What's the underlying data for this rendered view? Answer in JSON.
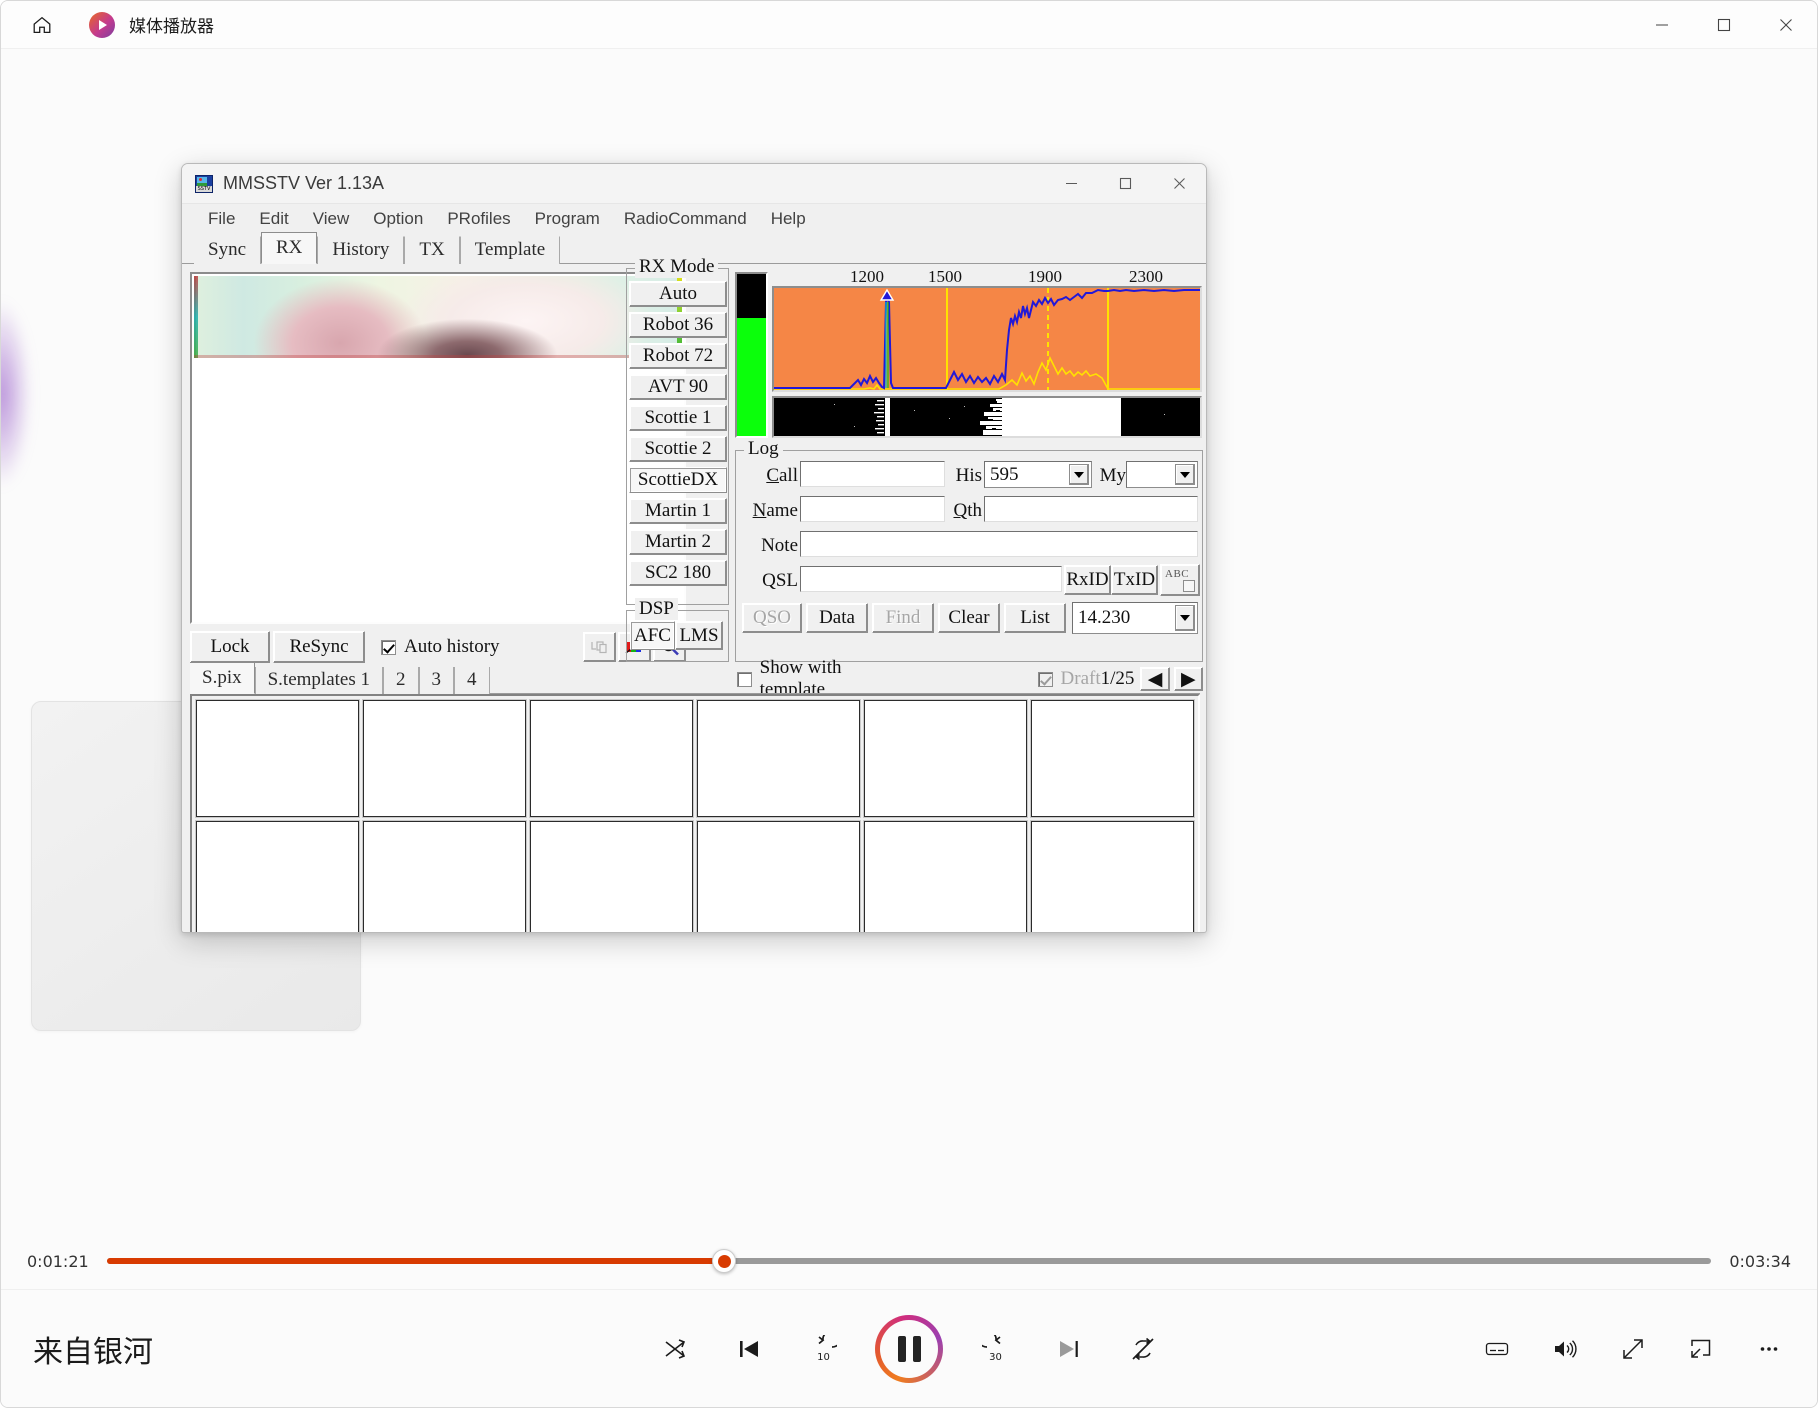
{
  "player": {
    "app_title": "媒体播放器",
    "home_icon": "home-icon",
    "window_controls": {
      "minimize": "—",
      "maximize": "□",
      "close": "✕"
    },
    "track_title": "来自银河",
    "time_current": "0:01:21",
    "time_total": "0:03:34",
    "progress_percent": 38.5,
    "accent_color": "#d83b01",
    "transport": [
      {
        "name": "shuffle-button",
        "label": "shuffle"
      },
      {
        "name": "previous-button",
        "label": "previous"
      },
      {
        "name": "rewind-10-button",
        "label": "10"
      },
      {
        "name": "play-pause-button",
        "label": "pause"
      },
      {
        "name": "forward-30-button",
        "label": "30"
      },
      {
        "name": "next-button",
        "label": "next"
      },
      {
        "name": "repeat-button",
        "label": "repeat-off"
      }
    ],
    "right_controls": [
      {
        "name": "captions-button",
        "label": "captions"
      },
      {
        "name": "volume-button",
        "label": "volume"
      },
      {
        "name": "fullscreen-button",
        "label": "fullscreen"
      },
      {
        "name": "miniplayer-button",
        "label": "miniplayer"
      },
      {
        "name": "more-options-button",
        "label": "..."
      }
    ]
  },
  "mmsstv": {
    "title": "MMSSTV Ver 1.13A",
    "window_controls": {
      "minimize": "—",
      "maximize": "□",
      "close": "✕"
    },
    "menu": [
      "File",
      "Edit",
      "View",
      "Option",
      "PRofiles",
      "Program",
      "RadioCommand",
      "Help"
    ],
    "tabs": [
      {
        "label": "Sync",
        "selected": false
      },
      {
        "label": "RX",
        "selected": true
      },
      {
        "label": "History",
        "selected": false
      },
      {
        "label": "TX",
        "selected": false
      },
      {
        "label": "Template",
        "selected": false
      }
    ],
    "sub_tabs": [
      {
        "label": "S.pix",
        "selected": true
      },
      {
        "label": "S.templates 1",
        "selected": false
      },
      {
        "label": "2",
        "selected": false
      },
      {
        "label": "3",
        "selected": false
      },
      {
        "label": "4",
        "selected": false
      }
    ],
    "rx_controls": {
      "lock": "Lock",
      "resync": "ReSync",
      "auto_history_label": "Auto history",
      "auto_history_checked": true,
      "icons": [
        {
          "name": "copy-to-clipboard-icon"
        },
        {
          "name": "color-adjust-icon"
        },
        {
          "name": "zoom-search-icon"
        }
      ]
    },
    "rx_mode": {
      "legend": "RX Mode",
      "modes": [
        {
          "label": "Auto",
          "selected": false
        },
        {
          "label": "Robot 36",
          "selected": false
        },
        {
          "label": "Robot 72",
          "selected": false
        },
        {
          "label": "AVT 90",
          "selected": false
        },
        {
          "label": "Scottie 1",
          "selected": false
        },
        {
          "label": "Scottie 2",
          "selected": false
        },
        {
          "label": "ScottieDX",
          "selected": true
        },
        {
          "label": "Martin 1",
          "selected": false
        },
        {
          "label": "Martin 2",
          "selected": false
        },
        {
          "label": "SC2 180",
          "selected": false
        }
      ]
    },
    "dsp": {
      "legend": "DSP",
      "afc": {
        "label": "AFC",
        "active": true
      },
      "lms": {
        "label": "LMS",
        "active": false
      }
    },
    "spectrum": {
      "axis_labels": [
        "1200",
        "1500",
        "1900",
        "2300"
      ],
      "meter_level_percent": 73,
      "bg_color": "#f58646",
      "trace_color": "#2218d8",
      "marker_color": "#ffe100"
    },
    "log": {
      "legend": "Log",
      "fields": {
        "call_label": "Call",
        "call_value": "",
        "his_label": "His",
        "his_value": "595",
        "my_label": "My",
        "my_value": "",
        "name_label": "Name",
        "name_value": "",
        "qth_label": "Qth",
        "qth_value": "",
        "note_label": "Note",
        "note_value": "",
        "qsl_label": "QSL",
        "qsl_value": "",
        "freq_value": "14.230"
      },
      "buttons": [
        {
          "label": "RxID",
          "enabled": true
        },
        {
          "label": "TxID",
          "enabled": true
        },
        {
          "label": "ABC",
          "enabled": true
        }
      ],
      "action_buttons": [
        {
          "label": "QSO",
          "enabled": false
        },
        {
          "label": "Data",
          "enabled": true
        },
        {
          "label": "Find",
          "enabled": false
        },
        {
          "label": "Clear",
          "enabled": true
        },
        {
          "label": "List",
          "enabled": true
        }
      ]
    },
    "bottom_strip": {
      "show_with_template_label": "Show with template",
      "show_with_template_checked": false,
      "draft_label": "Draft",
      "draft_checked": true,
      "draft_enabled": false,
      "page_indicator": "1/25",
      "prev_arrow": "◀",
      "next_arrow": "▶"
    },
    "thumbnail_count": 12
  }
}
